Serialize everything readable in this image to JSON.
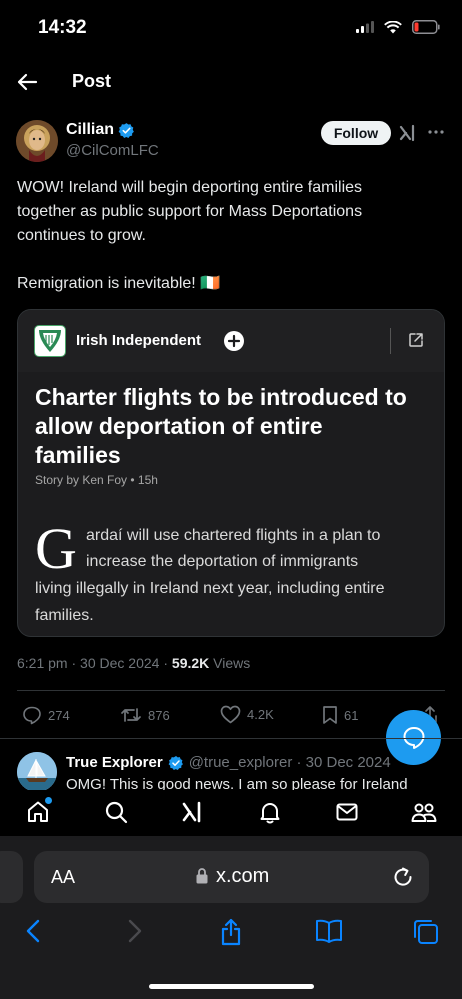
{
  "status": {
    "time": "14:32"
  },
  "nav": {
    "title": "Post"
  },
  "author": {
    "name": "Cillian",
    "handle": "@CilComLFC",
    "follow_label": "Follow"
  },
  "tweet": {
    "lines": [
      "WOW! Ireland will begin deporting entire families",
      "together as public support for Mass Deportations",
      "continues to grow."
    ],
    "line2": "Remigration is inevitable! 🇮🇪"
  },
  "card": {
    "source": "Irish Independent",
    "headline_lines": [
      "Charter flights to be introduced to",
      "allow deportation of entire",
      "families"
    ],
    "byline": "Story by Ken Foy • 15h",
    "dropcap": "G",
    "body_lines": [
      "ardaí will use chartered flights in a plan to",
      "increase the deportation of immigrants",
      "living illegally in Ireland next year, including entire",
      "families."
    ]
  },
  "meta": {
    "time": "6:21 pm",
    "date": "30 Dec 2024",
    "views_count": "59.2K",
    "views_label": "Views"
  },
  "actions": {
    "replies": "274",
    "reposts": "876",
    "likes": "4.2K",
    "bookmarks": "61"
  },
  "reply": {
    "name": "True Explorer",
    "handle_date": "@true_explorer · 30 Dec 2024",
    "text": "OMG! This is good news. I am so please for Ireland"
  },
  "browser": {
    "aa": "AA",
    "url": "x.com"
  },
  "icons": [
    "back-arrow-icon",
    "verified-badge-icon",
    "grok-icon",
    "more-icon",
    "external-link-icon",
    "plus-icon",
    "reply-icon",
    "repost-icon",
    "like-icon",
    "bookmark-icon",
    "share-icon",
    "chat-bubble-icon",
    "home-icon",
    "search-icon",
    "grok-tab-icon",
    "notifications-icon",
    "messages-icon",
    "communities-icon",
    "lock-icon",
    "reload-icon",
    "safari-back-icon",
    "safari-forward-icon",
    "safari-share-icon",
    "bookmarks-book-icon",
    "tabs-icon"
  ],
  "colors": {
    "accent": "#1d9bf0",
    "background": "#000000",
    "card": "#1c1c1e"
  }
}
